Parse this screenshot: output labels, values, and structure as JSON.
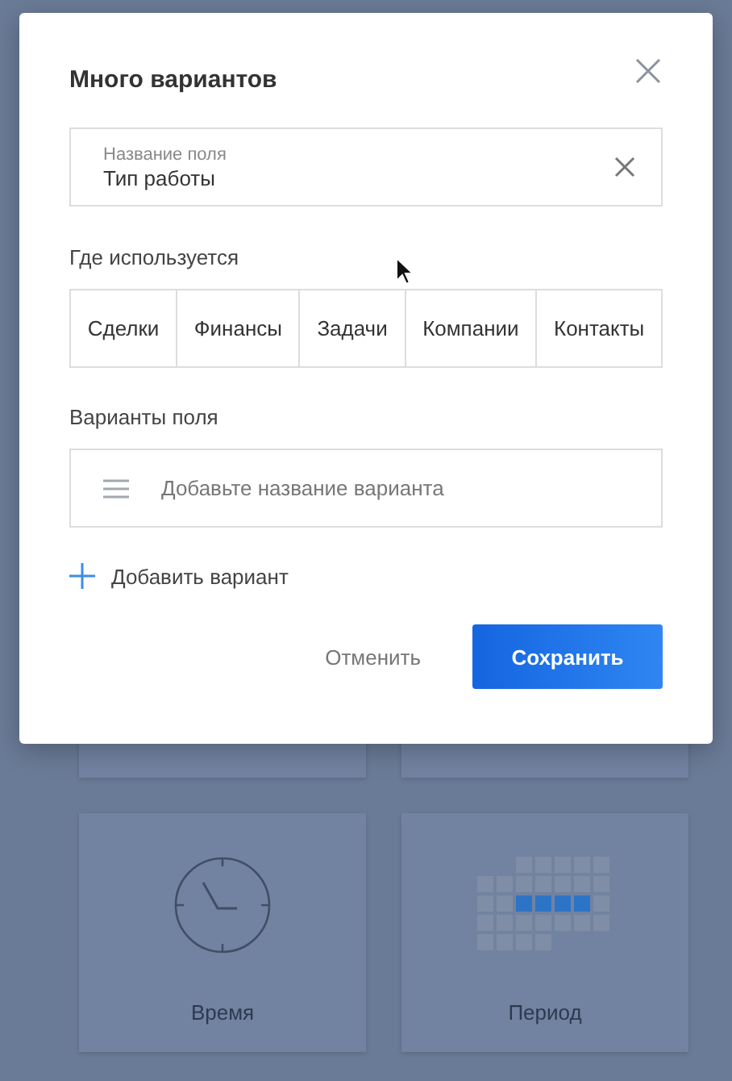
{
  "dialog": {
    "title": "Много вариантов",
    "name_field": {
      "label": "Название поля",
      "value": "Тип работы"
    },
    "usage_label": "Где используется",
    "usage_options": [
      {
        "label": "Сделки"
      },
      {
        "label": "Финансы"
      },
      {
        "label": "Задачи"
      },
      {
        "label": "Компании"
      },
      {
        "label": "Контакты"
      }
    ],
    "variants_label": "Варианты поля",
    "variant_field": {
      "placeholder": "Добавьте название варианта"
    },
    "add_variant": "Добавить вариант",
    "buttons": [
      {
        "label": "Отменить",
        "kind": "secondary"
      },
      {
        "label": "Сохранить",
        "kind": "primary"
      }
    ]
  },
  "background_cards": [
    {
      "label": "Время",
      "kind": "clock"
    },
    {
      "label": "Период",
      "kind": "calendar"
    }
  ]
}
